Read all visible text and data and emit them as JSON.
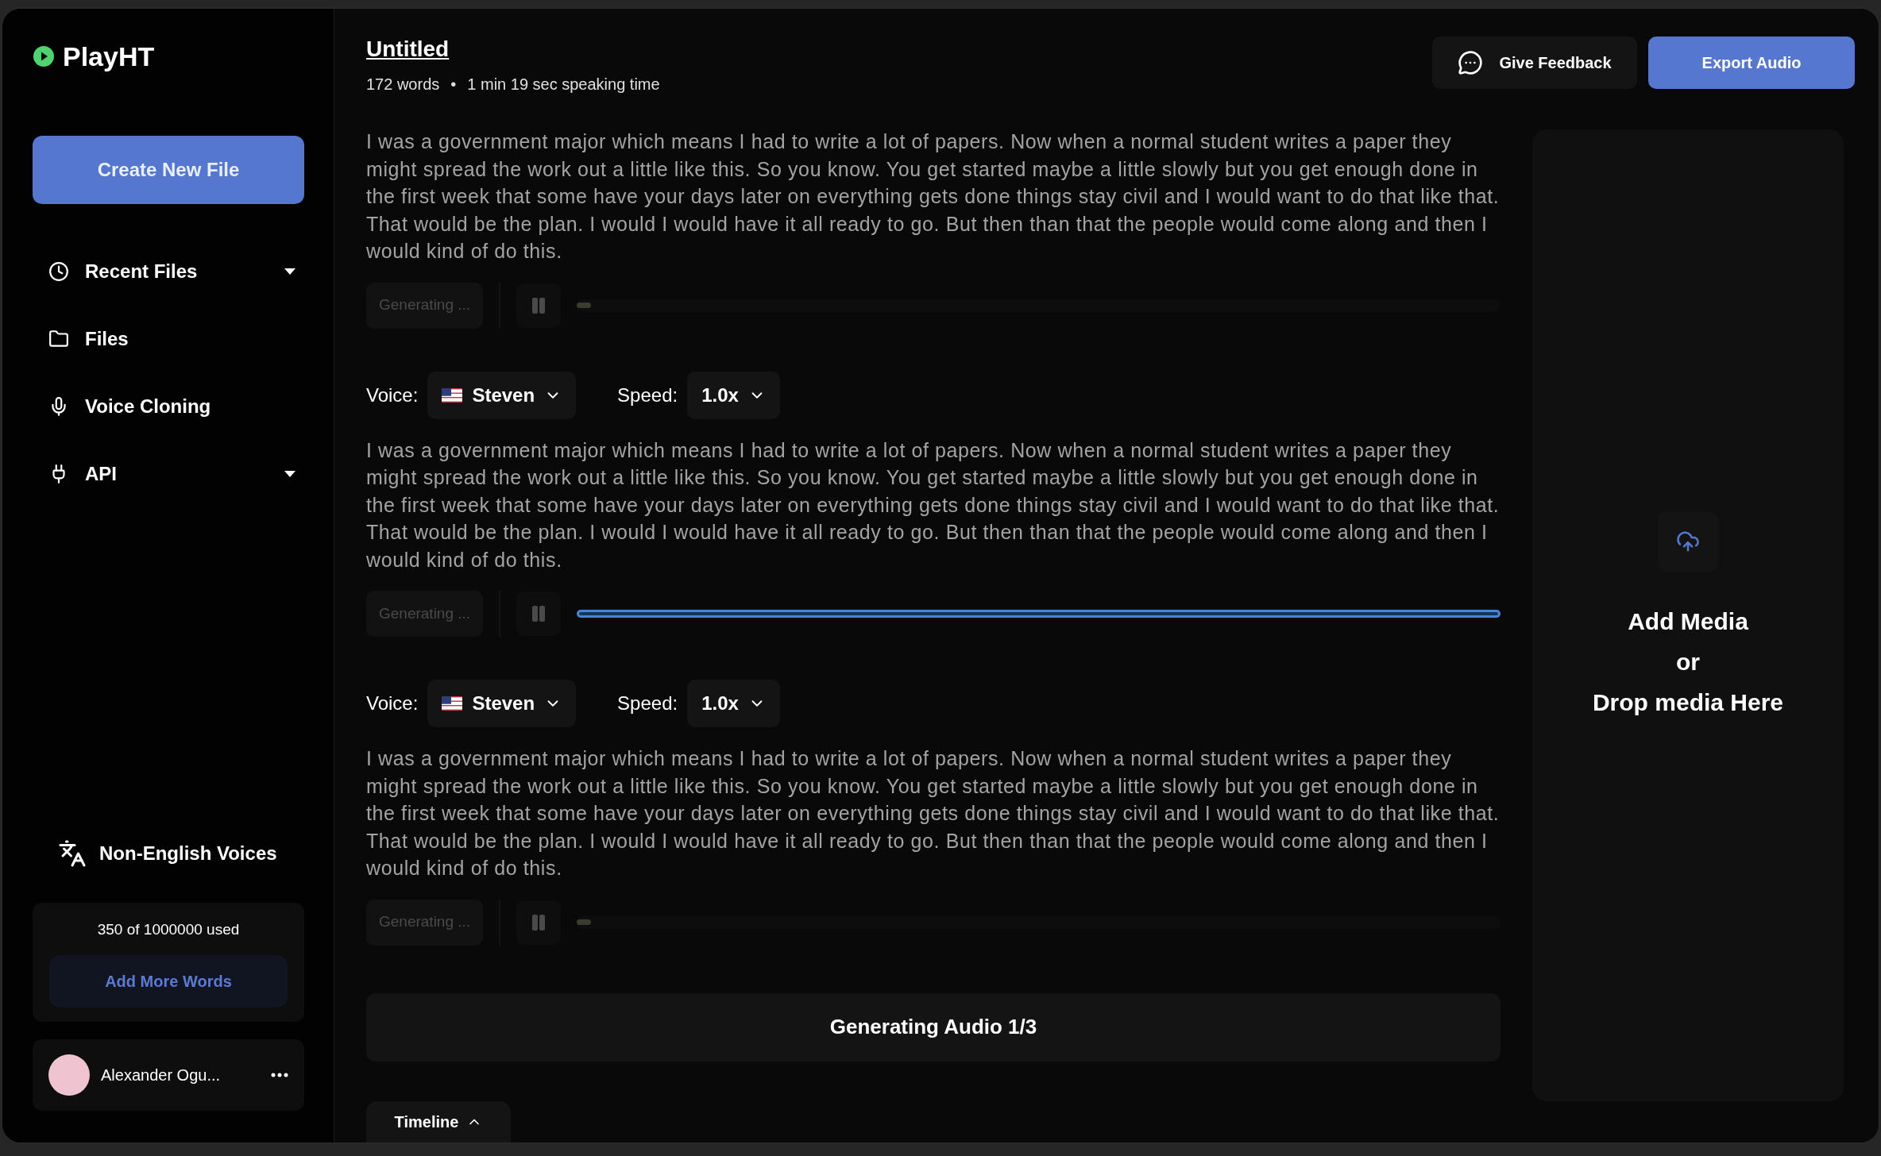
{
  "logo": {
    "name": "PlayHT"
  },
  "sidebar": {
    "create_button": "Create New File",
    "items": [
      {
        "label": "Recent Files",
        "kind": "dropdown"
      },
      {
        "label": "Files",
        "kind": "link"
      },
      {
        "label": "Voice Cloning",
        "kind": "link"
      },
      {
        "label": "API",
        "kind": "dropdown"
      }
    ],
    "languages": "Non-English Voices",
    "usage": {
      "text": "350 of 1000000 used",
      "button": "Add More Words"
    },
    "user": {
      "name": "Alexander Ogu..."
    }
  },
  "document": {
    "title": "Untitled",
    "words": "172 words",
    "separator": "•",
    "speaking_time": "1 min 19 sec speaking time"
  },
  "header_buttons": {
    "feedback": "Give Feedback",
    "export": "Export Audio"
  },
  "blocks": [
    {
      "text": "I was a government major which means I had to write a lot of papers. Now when a normal student writes a paper they might spread the work out a little like this. So you know. You get started maybe a little slowly but you get enough done in the first week that some have your days later on everything gets done things stay civil and I would want to do that like that. That would be the plan. I would I would have it all ready to go. But then than that the people would come along and then I would kind of do this.",
      "status": "Generating ...",
      "level": 0.015
    },
    {
      "voice_label": "Voice:",
      "voice": "Steven",
      "speed_label": "Speed:",
      "speed": "1.0x",
      "text": "I was a government major which means I had to write a lot of papers. Now when a normal student writes a paper they might spread the work out a little like this. So you know. You get started maybe a little slowly but you get enough done in the first week that some have your days later on everything gets done things stay civil and I would want to do that like that. That would be the plan. I would I would have it all ready to go. But then than that the people would come along and then I would kind of do this.",
      "status": "Generating ...",
      "level": 1
    },
    {
      "voice_label": "Voice:",
      "voice": "Steven",
      "speed_label": "Speed:",
      "speed": "1.0x",
      "text": "I was a government major which means I had to write a lot of papers. Now when a normal student writes a paper they might spread the work out a little like this. So you know. You get started maybe a little slowly but you get enough done in the first week that some have your days later on everything gets done things stay civil and I would want to do that like that. That would be the plan. I would I would have it all ready to go. But then than that the people would come along and then I would kind of do this.",
      "status": "Generating ...",
      "level": 0.015
    }
  ],
  "generating_banner": "Generating Audio 1/3",
  "timeline_tab": "Timeline",
  "media_panel": {
    "lines": [
      "Add Media",
      "or",
      "Drop media Here"
    ]
  }
}
